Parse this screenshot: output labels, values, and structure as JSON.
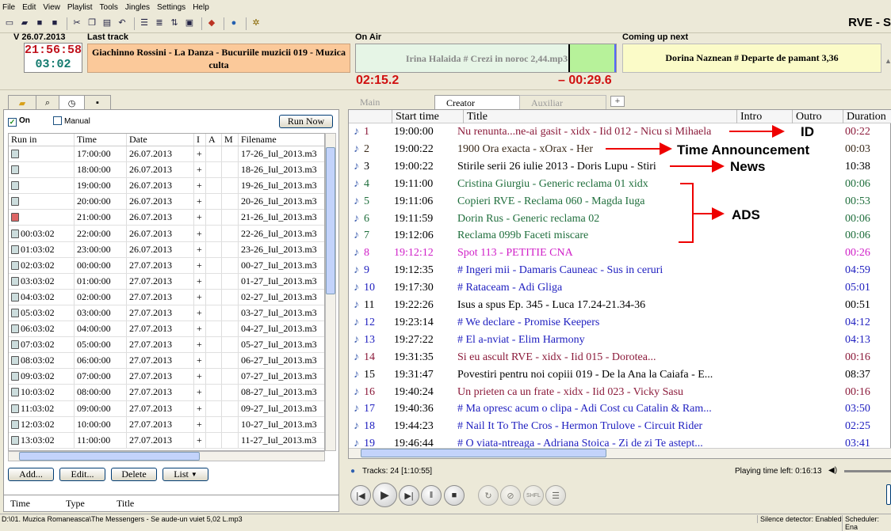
{
  "menu": [
    "File",
    "Edit",
    "View",
    "Playlist",
    "Tools",
    "Jingles",
    "Settings",
    "Help"
  ],
  "brand": "RVE - S",
  "date_label": "V 26.07.2013",
  "clock": {
    "time": "21:56:58",
    "remain": "03:02"
  },
  "last_track": {
    "label": "Last track",
    "text": "Giachinno Rossini - La Danza - Bucuriile muzicii 019 - Muzica culta"
  },
  "on_air": {
    "label": "On Air",
    "text": "Irina Halaida # Crezi in noroc 2,44.mp3",
    "elapsed": "02:15.2",
    "remaining": "– 00:29.6",
    "progress": 0.81
  },
  "next": {
    "label": "Coming up next",
    "text": "Dorina Naznean # Departe de pamant   3,36"
  },
  "scheduler": {
    "on_label": "On",
    "manual_label": "Manual",
    "run_now": "Run Now",
    "columns": [
      "Run in",
      "Time",
      "Date",
      "I",
      "A",
      "M",
      "Filename"
    ],
    "rows": [
      {
        "runin": "",
        "time": "17:00:00",
        "date": "26.07.2013",
        "i": "+",
        "file": "17-26_Iul_2013.m3"
      },
      {
        "runin": "",
        "time": "18:00:00",
        "date": "26.07.2013",
        "i": "+",
        "file": "18-26_Iul_2013.m3"
      },
      {
        "runin": "",
        "time": "19:00:00",
        "date": "26.07.2013",
        "i": "+",
        "file": "19-26_Iul_2013.m3"
      },
      {
        "runin": "",
        "time": "20:00:00",
        "date": "26.07.2013",
        "i": "+",
        "file": "20-26_Iul_2013.m3"
      },
      {
        "runin": "",
        "time": "21:00:00",
        "date": "26.07.2013",
        "i": "+",
        "file": "21-26_Iul_2013.m3",
        "red": true
      },
      {
        "runin": "00:03:02",
        "time": "22:00:00",
        "date": "26.07.2013",
        "i": "+",
        "file": "22-26_Iul_2013.m3"
      },
      {
        "runin": "01:03:02",
        "time": "23:00:00",
        "date": "26.07.2013",
        "i": "+",
        "file": "23-26_Iul_2013.m3"
      },
      {
        "runin": "02:03:02",
        "time": "00:00:00",
        "date": "27.07.2013",
        "i": "+",
        "file": "00-27_Iul_2013.m3"
      },
      {
        "runin": "03:03:02",
        "time": "01:00:00",
        "date": "27.07.2013",
        "i": "+",
        "file": "01-27_Iul_2013.m3"
      },
      {
        "runin": "04:03:02",
        "time": "02:00:00",
        "date": "27.07.2013",
        "i": "+",
        "file": "02-27_Iul_2013.m3"
      },
      {
        "runin": "05:03:02",
        "time": "03:00:00",
        "date": "27.07.2013",
        "i": "+",
        "file": "03-27_Iul_2013.m3"
      },
      {
        "runin": "06:03:02",
        "time": "04:00:00",
        "date": "27.07.2013",
        "i": "+",
        "file": "04-27_Iul_2013.m3"
      },
      {
        "runin": "07:03:02",
        "time": "05:00:00",
        "date": "27.07.2013",
        "i": "+",
        "file": "05-27_Iul_2013.m3"
      },
      {
        "runin": "08:03:02",
        "time": "06:00:00",
        "date": "27.07.2013",
        "i": "+",
        "file": "06-27_Iul_2013.m3"
      },
      {
        "runin": "09:03:02",
        "time": "07:00:00",
        "date": "27.07.2013",
        "i": "+",
        "file": "07-27_Iul_2013.m3"
      },
      {
        "runin": "10:03:02",
        "time": "08:00:00",
        "date": "27.07.2013",
        "i": "+",
        "file": "08-27_Iul_2013.m3"
      },
      {
        "runin": "11:03:02",
        "time": "09:00:00",
        "date": "27.07.2013",
        "i": "+",
        "file": "09-27_Iul_2013.m3"
      },
      {
        "runin": "12:03:02",
        "time": "10:00:00",
        "date": "27.07.2013",
        "i": "+",
        "file": "10-27_Iul_2013.m3"
      },
      {
        "runin": "13:03:02",
        "time": "11:00:00",
        "date": "27.07.2013",
        "i": "+",
        "file": "11-27_Iul_2013.m3"
      }
    ],
    "buttons": [
      "Add...",
      "Edit...",
      "Delete",
      "List"
    ]
  },
  "lower_grid": {
    "columns": [
      "Time",
      "Type",
      "Title"
    ]
  },
  "playlist": {
    "tabs": [
      "Main",
      "Creator",
      "Auxiliar"
    ],
    "columns": [
      "Start time",
      "Title",
      "Intro",
      "Outro",
      "Duration"
    ],
    "rows": [
      {
        "n": "1",
        "start": "19:00:00",
        "title": "Nu renunta...ne-ai gasit - xidx - Iid 012 - Nicu si Mihaela",
        "dur": "00:22",
        "color": "#8b1a3a",
        "durcolor": "#8b1a3a"
      },
      {
        "n": "2",
        "start": "19:00:22",
        "title": "1900 Ora exacta - xOrax - Her",
        "dur": "00:03",
        "color": "#3a2a1a",
        "durcolor": "#3a2a1a"
      },
      {
        "n": "3",
        "start": "19:00:22",
        "title": "Stirile serii 26 iulie 2013 - Doris Lupu - Stiri",
        "dur": "10:38",
        "color": "#000000",
        "durcolor": "#000000"
      },
      {
        "n": "4",
        "start": "19:11:00",
        "title": "Cristina Giurgiu - Generic reclama 01 xidx",
        "dur": "00:06",
        "color": "#1f6e3c",
        "durcolor": "#1f6e3c"
      },
      {
        "n": "5",
        "start": "19:11:06",
        "title": "Copieri RVE - Reclama 060 - Magda Iuga",
        "dur": "00:53",
        "color": "#1f6e3c",
        "durcolor": "#1f6e3c"
      },
      {
        "n": "6",
        "start": "19:11:59",
        "title": "Dorin Rus - Generic reclama 02",
        "dur": "00:06",
        "color": "#1f6e3c",
        "durcolor": "#1f6e3c"
      },
      {
        "n": "7",
        "start": "19:12:06",
        "title": "Reclama 099b Faceti miscare",
        "dur": "00:06",
        "color": "#1f6e3c",
        "durcolor": "#1f6e3c"
      },
      {
        "n": "8",
        "start": "19:12:12",
        "title": "Spot 113 - PETITIE CNA",
        "dur": "00:26",
        "color": "#d020c8",
        "durcolor": "#d020c8"
      },
      {
        "n": "9",
        "start": "19:12:35",
        "title": "# Ingeri mii - Damaris Cauneac - Sus in ceruri",
        "dur": "04:59",
        "color": "#2020c0",
        "durcolor": "#2020c0"
      },
      {
        "n": "10",
        "start": "19:17:30",
        "title": "# Rataceam - Adi Gliga",
        "dur": "05:01",
        "color": "#2020c0",
        "durcolor": "#2020c0"
      },
      {
        "n": "11",
        "start": "19:22:26",
        "title": "Isus a spus Ep. 345 - Luca 17.24-21.34-36",
        "dur": "00:51",
        "color": "#000000",
        "durcolor": "#000000"
      },
      {
        "n": "12",
        "start": "19:23:14",
        "title": "# We declare - Promise Keepers",
        "dur": "04:12",
        "color": "#2020c0",
        "durcolor": "#2020c0"
      },
      {
        "n": "13",
        "start": "19:27:22",
        "title": "# El a-nviat - Elim Harmony",
        "dur": "04:13",
        "color": "#2020c0",
        "durcolor": "#2020c0"
      },
      {
        "n": "14",
        "start": "19:31:35",
        "title": "Si eu ascult RVE - xidx - Iid 015 - Dorotea...",
        "dur": "00:16",
        "color": "#8b1a3a",
        "durcolor": "#8b1a3a"
      },
      {
        "n": "15",
        "start": "19:31:47",
        "title": "Povestiri pentru noi copiii 019 - De la Ana la Caiafa - E...",
        "dur": "08:37",
        "color": "#000000",
        "durcolor": "#000000"
      },
      {
        "n": "16",
        "start": "19:40:24",
        "title": "Un prieten ca un frate - xidx - Iid 023 - Vicky Sasu",
        "dur": "00:16",
        "color": "#8b1a3a",
        "durcolor": "#8b1a3a"
      },
      {
        "n": "17",
        "start": "19:40:36",
        "title": "# Ma opresc acum o clipa - Adi Cost cu Catalin & Ram...",
        "dur": "03:50",
        "color": "#2020c0",
        "durcolor": "#2020c0"
      },
      {
        "n": "18",
        "start": "19:44:23",
        "title": "# Nail It To The Cros - Hermon Trulove - Circuit Rider",
        "dur": "02:25",
        "color": "#2020c0",
        "durcolor": "#2020c0"
      },
      {
        "n": "19",
        "start": "19:46:44",
        "title": "# O viata-ntreaga - Adriana Stoica - Zi de zi Te astept...",
        "dur": "03:41",
        "color": "#2020c0",
        "durcolor": "#2020c0"
      }
    ],
    "tracks": "Tracks: 24 [1:10:55]",
    "playing_left": "Playing time left: 0:16:13"
  },
  "annotations": {
    "id": "ID",
    "time": "Time Announcement",
    "news": "News",
    "ads": "ADS"
  },
  "statusbar": {
    "left": "D:\\01. Muzica Romaneasca\\The Messengers - Se aude-un vuiet      5,02      L.mp3",
    "silence": "Silence detector: Enabled",
    "scheduler": "Scheduler: Ena"
  }
}
